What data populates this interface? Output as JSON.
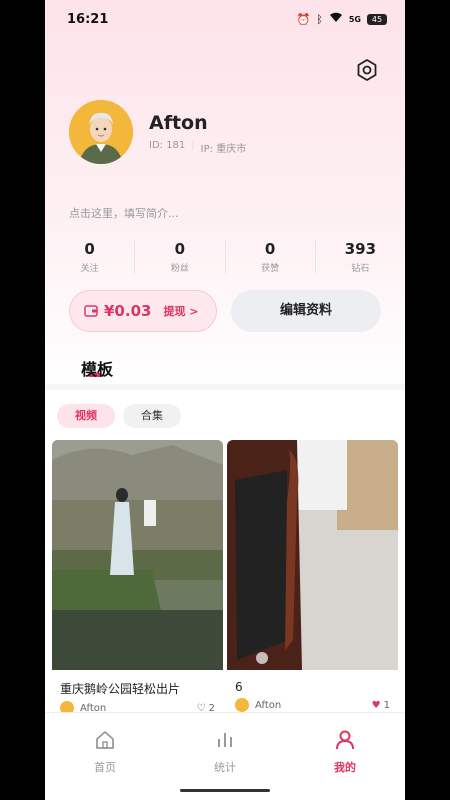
{
  "status_bar": {
    "time": "16:21",
    "network": "5G",
    "battery": "45"
  },
  "profile": {
    "name": "Afton",
    "id_label": "ID: 181",
    "ip_label": "IP: 重庆市",
    "bio_placeholder": "点击这里，填写简介..."
  },
  "stats": [
    {
      "value": "0",
      "label": "关注"
    },
    {
      "value": "0",
      "label": "粉丝"
    },
    {
      "value": "0",
      "label": "获赞"
    },
    {
      "value": "393",
      "label": "钻石"
    }
  ],
  "wallet": {
    "amount": "¥0.03",
    "withdraw_label": "提现 >"
  },
  "edit_button_label": "编辑资料",
  "section_title": "模板",
  "content_tabs": [
    {
      "label": "视频",
      "active": true
    },
    {
      "label": "合集",
      "active": false
    }
  ],
  "cards": [
    {
      "title": "重庆鹅岭公园轻松出片",
      "author": "Afton",
      "likes": "2"
    },
    {
      "title": "6",
      "author": "Afton",
      "likes": "1"
    }
  ],
  "bottom_nav": [
    {
      "label": "首页",
      "icon": "home-icon",
      "active": false
    },
    {
      "label": "统计",
      "icon": "bar-chart-icon",
      "active": false
    },
    {
      "label": "我的",
      "icon": "person-icon",
      "active": true
    }
  ],
  "colors": {
    "accent": "#e03561",
    "wallet_bg": "#fde8ee",
    "button_gray": "#eceef2"
  }
}
